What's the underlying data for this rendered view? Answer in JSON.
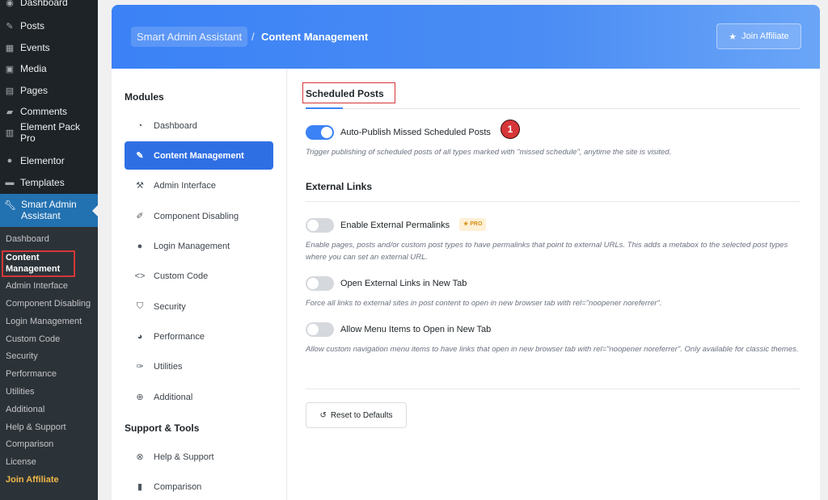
{
  "wp_nav": {
    "items": [
      {
        "label": "Dashboard",
        "icon": "dashboard-icon"
      },
      {
        "label": "Posts",
        "icon": "pin-icon"
      },
      {
        "label": "Events",
        "icon": "calendar-icon"
      },
      {
        "label": "Media",
        "icon": "media-icon"
      },
      {
        "label": "Pages",
        "icon": "page-icon"
      },
      {
        "label": "Comments",
        "icon": "comment-icon"
      },
      {
        "label": "Element Pack Pro",
        "icon": "element-pack-icon"
      },
      {
        "label": "Elementor",
        "icon": "elementor-icon"
      },
      {
        "label": "Templates",
        "icon": "folder-icon"
      }
    ],
    "active": {
      "label": "Smart Admin Assistant",
      "icon": "wrench-icon"
    },
    "submenu": [
      "Dashboard",
      "Content Management",
      "Admin Interface",
      "Component Disabling",
      "Login Management",
      "Custom Code",
      "Security",
      "Performance",
      "Utilities",
      "Additional",
      "Help & Support",
      "Comparison",
      "License",
      "Join Affiliate"
    ]
  },
  "header": {
    "breadcrumb_root": "Smart Admin Assistant",
    "separator": "/",
    "breadcrumb_current": "Content Management",
    "join_label": "Join Affiliate"
  },
  "modules": {
    "title": "Modules",
    "items": [
      {
        "label": "Dashboard",
        "icon": "gauge-icon"
      },
      {
        "label": "Content Management",
        "icon": "pin-icon"
      },
      {
        "label": "Admin Interface",
        "icon": "hammer-icon"
      },
      {
        "label": "Component Disabling",
        "icon": "brush-icon"
      },
      {
        "label": "Login Management",
        "icon": "user-icon"
      },
      {
        "label": "Custom Code",
        "icon": "code-icon"
      },
      {
        "label": "Security",
        "icon": "shield-icon"
      },
      {
        "label": "Performance",
        "icon": "speedometer-icon"
      },
      {
        "label": "Utilities",
        "icon": "wrench-icon"
      },
      {
        "label": "Additional",
        "icon": "plus-circle-icon"
      }
    ],
    "support_title": "Support & Tools",
    "support_items": [
      {
        "label": "Help & Support",
        "icon": "lifebuoy-icon"
      },
      {
        "label": "Comparison",
        "icon": "bar-chart-icon"
      }
    ]
  },
  "main": {
    "scheduled": {
      "title": "Scheduled Posts",
      "toggle_label": "Auto-Publish Missed Scheduled Posts",
      "toggle_on": true,
      "marker": "1",
      "description": "Trigger publishing of scheduled posts of all types marked with \"missed schedule\", anytime the site is visited."
    },
    "external": {
      "title": "External Links",
      "options": [
        {
          "label": "Enable External Permalinks",
          "on": false,
          "badge": "PRO",
          "description": "Enable pages, posts and/or custom post types to have permalinks that point to external URLs. This adds a metabox to the selected post types where you can set an external URL."
        },
        {
          "label": "Open External Links in New Tab",
          "on": false,
          "description": "Force all links to external sites in post content to open in new browser tab with rel=\"noopener noreferrer\"."
        },
        {
          "label": "Allow Menu Items to Open in New Tab",
          "on": false,
          "description": "Allow custom navigation menu items to have links that open in new browser tab with rel=\"noopener noreferrer\". Only available for classic themes."
        }
      ]
    },
    "reset_label": "Reset to Defaults"
  },
  "colors": {
    "accent": "#3b82f6",
    "highlight": "#d63638",
    "sidebar": "#1d2327"
  }
}
